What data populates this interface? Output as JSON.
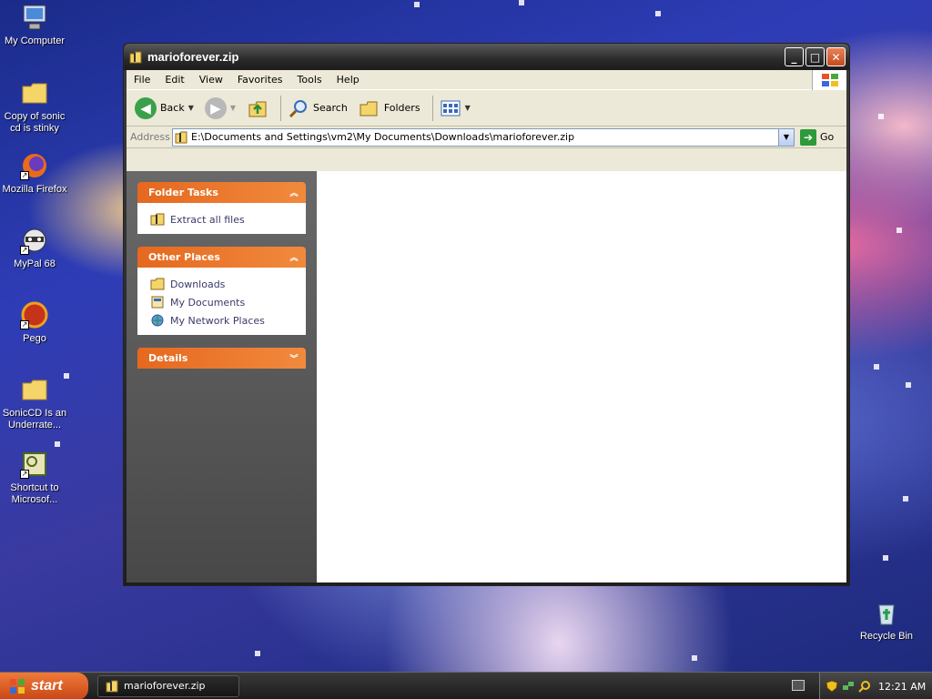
{
  "desktop": {
    "icons": [
      {
        "label": "My Computer"
      },
      {
        "label": "Copy of sonic cd is stinky"
      },
      {
        "label": "Mozilla Firefox"
      },
      {
        "label": "MyPal 68"
      },
      {
        "label": "Pego"
      },
      {
        "label": "SonicCD Is an Underrate..."
      },
      {
        "label": "Shortcut to Microsof..."
      },
      {
        "label": "Recycle Bin"
      }
    ]
  },
  "window": {
    "title": "marioforever.zip",
    "menu": [
      "File",
      "Edit",
      "View",
      "Favorites",
      "Tools",
      "Help"
    ],
    "toolbar": {
      "back": "Back",
      "search": "Search",
      "folders": "Folders"
    },
    "address": {
      "label": "Address",
      "value": "E:\\Documents and Settings\\vm2\\My Documents\\Downloads\\marioforever.zip",
      "go": "Go"
    },
    "panels": [
      {
        "title": "Folder Tasks",
        "links": [
          "Extract all files"
        ]
      },
      {
        "title": "Other Places",
        "links": [
          "Downloads",
          "My Documents",
          "My Network Places"
        ]
      },
      {
        "title": "Details",
        "links": []
      }
    ]
  },
  "taskbar": {
    "start_label": "start",
    "task_label": "marioforever.zip",
    "clock": "12:21 AM"
  },
  "colors": {
    "panel_header": "#e5681e",
    "start_button": "#e0632a",
    "go_arrow": "#2e9a3a"
  }
}
